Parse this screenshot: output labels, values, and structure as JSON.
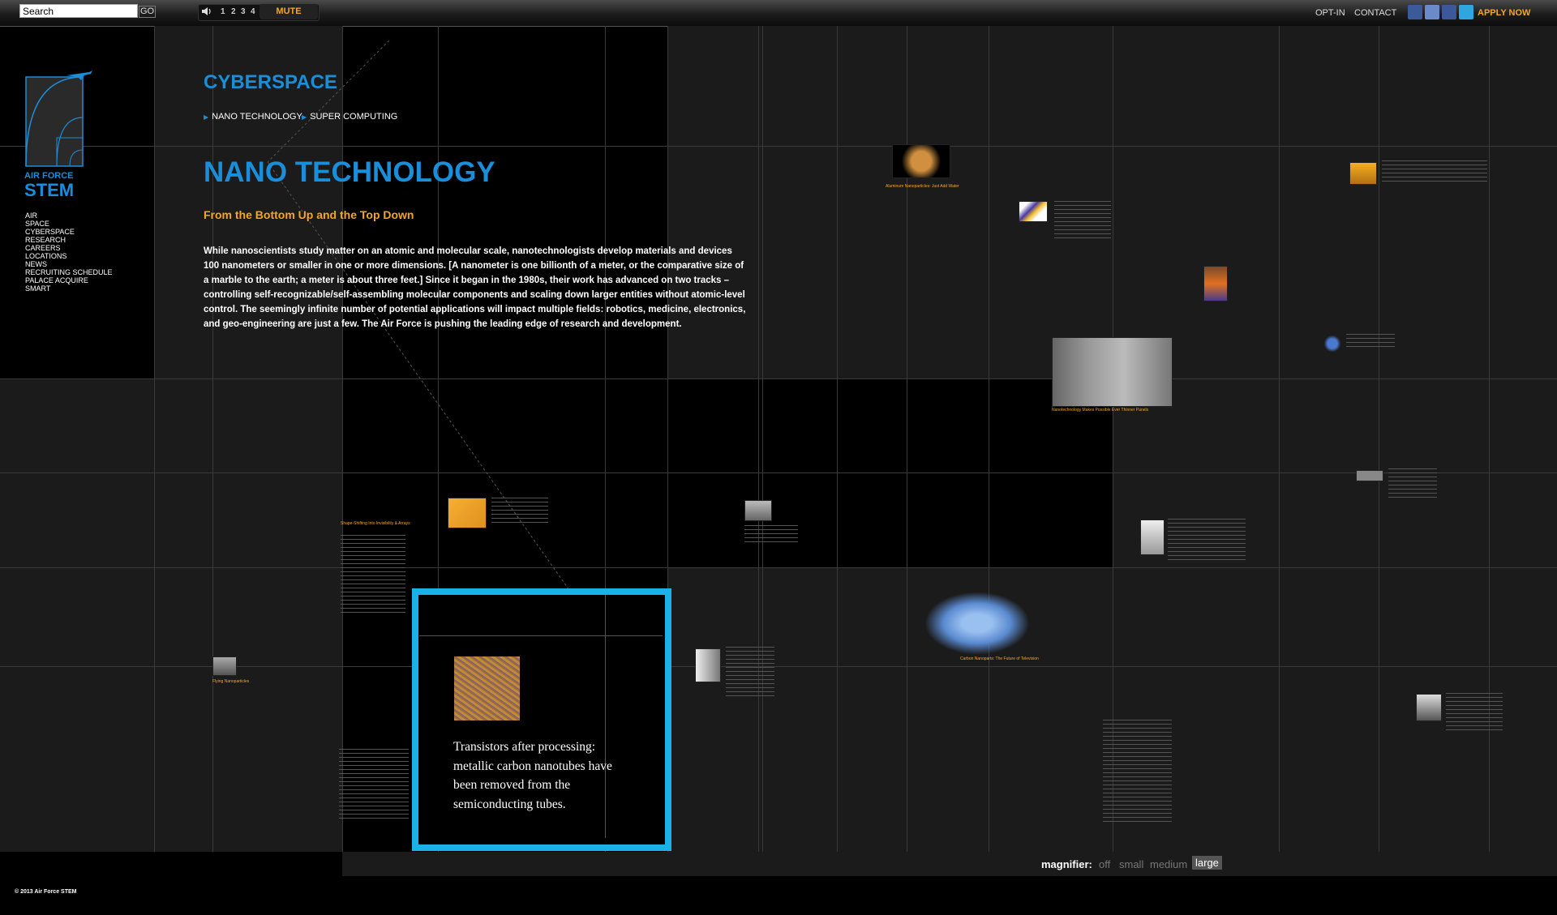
{
  "topbar": {
    "search_value": "Search",
    "go_label": "GO",
    "tracks": [
      "1",
      "2",
      "3",
      "4"
    ],
    "mute_label": "MUTE",
    "links": [
      "OPT-IN",
      "CONTACT"
    ],
    "apply_label": "APPLY NOW",
    "social_icons": [
      "email-icon",
      "myspace-icon",
      "facebook-icon",
      "twitter-icon"
    ]
  },
  "logo": {
    "line1": "AIR FORCE",
    "line2": "STEM"
  },
  "nav": [
    "AIR",
    "SPACE",
    "CYBERSPACE",
    "RESEARCH",
    "CAREERS",
    "LOCATIONS",
    "NEWS",
    "RECRUITING SCHEDULE",
    "PALACE ACQUIRE",
    "SMART"
  ],
  "section": {
    "title": "CYBERSPACE",
    "subnav": [
      "NANO TECHNOLOGY",
      "SUPER COMPUTING"
    ]
  },
  "main": {
    "heading": "NANO TECHNOLOGY",
    "tagline": "From the Bottom Up and the Top Down",
    "body": "While nanoscientists study matter on an atomic and molecular scale, nanotechnologists develop materials and devices 100 nanometers or smaller in one or more dimensions. [A nanometer is one billionth of a meter, or the comparative size of a marble to the earth; a meter is about three feet.] Since it began in the 1980s, their work has advanced on two tracks – controlling self-recognizable/self-assembling molecular components and scaling down larger entities without atomic-level control. The seemingly infinite number of potential applications will impact multiple fields: robotics, medicine, electronics, and geo-engineering are just a few. The Air Force is pushing the leading edge of research and development."
  },
  "magnifier_popup": {
    "text": "Transistors after processing: metallic carbon nanotubes have been removed from the semiconducting tubes."
  },
  "captions": {
    "c1": "Aluminum Nanoparticles: Just Add Water",
    "c2": "Nanotechnology Makes Possible Ever Thinner Panels",
    "c3": "Carbon Nanoparts: The Future of Television",
    "c4": "Flying Nanoparticles",
    "c5": "Shape-Shifting Into Invisibility & Arrays"
  },
  "footer": {
    "copyright": "© 2013 Air Force STEM",
    "magnifier_label": "magnifier:",
    "magnifier_options": [
      "off",
      "small",
      "medium",
      "large"
    ],
    "magnifier_selected": "large"
  },
  "colors": {
    "accent_blue": "#1a8ed8",
    "accent_orange": "#f5a623",
    "magnifier_border": "#1ab0e8"
  }
}
